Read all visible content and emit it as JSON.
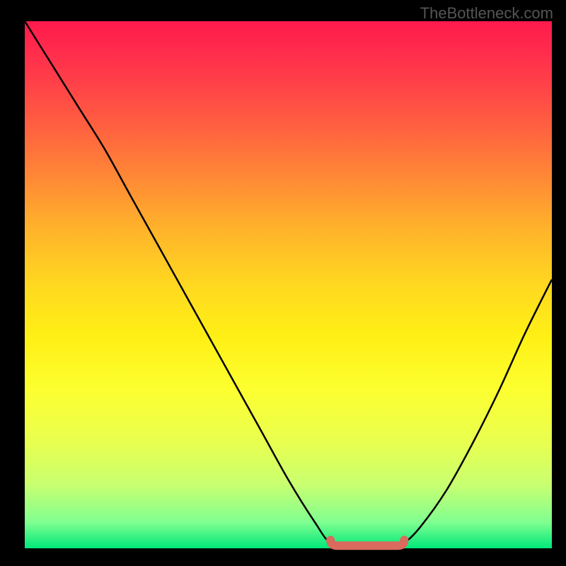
{
  "watermark": "TheBottleneck.com",
  "chart_data": {
    "type": "line",
    "title": "",
    "xlabel": "",
    "ylabel": "",
    "xlim": [
      0,
      100
    ],
    "ylim": [
      0,
      100
    ],
    "x": [
      0,
      5,
      10,
      15,
      20,
      25,
      30,
      35,
      40,
      45,
      50,
      55,
      58,
      62,
      66,
      70,
      72,
      75,
      80,
      85,
      90,
      95,
      100
    ],
    "values": [
      100,
      92,
      84,
      76,
      67,
      58,
      49,
      40,
      31,
      22,
      13,
      5,
      1,
      0,
      0,
      0,
      1,
      4,
      11,
      20,
      30,
      41,
      51
    ],
    "optimal_range_x": [
      58,
      72
    ],
    "background_gradient": {
      "top": "#ff1a4d",
      "mid": "#fff015",
      "bottom": "#00e87a"
    },
    "marker_color": "#d96a5d"
  }
}
